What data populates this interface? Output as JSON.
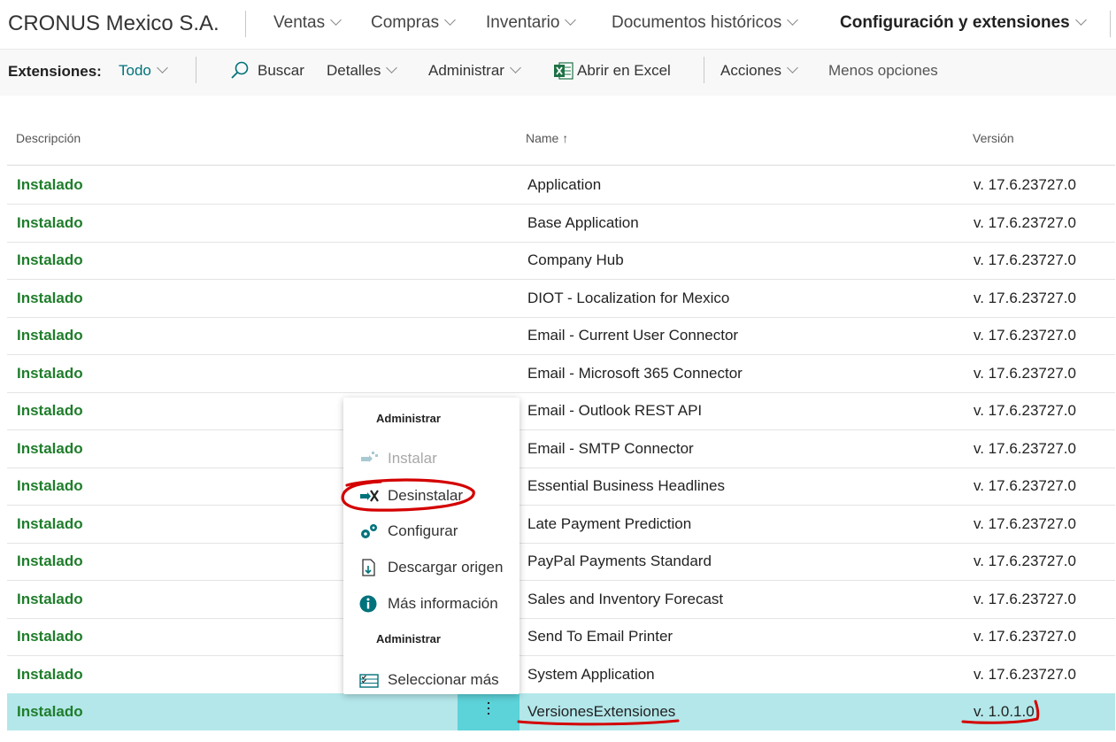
{
  "header": {
    "company": "CRONUS Mexico S.A.",
    "nav": [
      {
        "label": "Ventas",
        "bold": false
      },
      {
        "label": "Compras",
        "bold": false
      },
      {
        "label": "Inventario",
        "bold": false
      },
      {
        "label": "Documentos históricos",
        "bold": false
      },
      {
        "label": "Configuración y extensiones",
        "bold": true
      }
    ]
  },
  "toolbar": {
    "label": "Extensiones:",
    "filter": "Todo",
    "search": "Buscar",
    "details": "Detalles",
    "manage": "Administrar",
    "excel": "Abrir en Excel",
    "actions": "Acciones",
    "less": "Menos opciones"
  },
  "columns": {
    "description": "Descripción",
    "name": "Name",
    "name_sort": "↑",
    "version": "Versión"
  },
  "rows": [
    {
      "status": "Instalado",
      "name": "Application",
      "version": "v. 17.6.23727.0"
    },
    {
      "status": "Instalado",
      "name": "Base Application",
      "version": "v. 17.6.23727.0"
    },
    {
      "status": "Instalado",
      "name": "Company Hub",
      "version": "v. 17.6.23727.0"
    },
    {
      "status": "Instalado",
      "name": "DIOT - Localization for Mexico",
      "version": "v. 17.6.23727.0"
    },
    {
      "status": "Instalado",
      "name": "Email - Current User Connector",
      "version": "v. 17.6.23727.0"
    },
    {
      "status": "Instalado",
      "name": "Email - Microsoft 365 Connector",
      "version": "v. 17.6.23727.0"
    },
    {
      "status": "Instalado",
      "name": "Email - Outlook REST API",
      "version": "v. 17.6.23727.0"
    },
    {
      "status": "Instalado",
      "name": "Email - SMTP Connector",
      "version": "v. 17.6.23727.0"
    },
    {
      "status": "Instalado",
      "name": "Essential Business Headlines",
      "version": "v. 17.6.23727.0"
    },
    {
      "status": "Instalado",
      "name": "Late Payment Prediction",
      "version": "v. 17.6.23727.0"
    },
    {
      "status": "Instalado",
      "name": "PayPal Payments Standard",
      "version": "v. 17.6.23727.0"
    },
    {
      "status": "Instalado",
      "name": "Sales and Inventory Forecast",
      "version": "v. 17.6.23727.0"
    },
    {
      "status": "Instalado",
      "name": "Send To Email Printer",
      "version": "v. 17.6.23727.0"
    },
    {
      "status": "Instalado",
      "name": "System Application",
      "version": "v. 17.6.23727.0"
    },
    {
      "status": "Instalado",
      "name": "VersionesExtensiones",
      "version": "v. 1.0.1.0",
      "selected": true
    }
  ],
  "context_menu": {
    "heading1": "Administrar",
    "install": "Instalar",
    "uninstall": "Desinstalar",
    "configure": "Configurar",
    "download_source": "Descargar origen",
    "more_info": "Más información",
    "heading2": "Administrar",
    "select_more": "Seleccionar más"
  },
  "colors": {
    "status_green": "#1f7d2b",
    "accent_teal": "#00727b",
    "selected_row": "#b3e7ea",
    "annotation_red": "#d40000"
  }
}
